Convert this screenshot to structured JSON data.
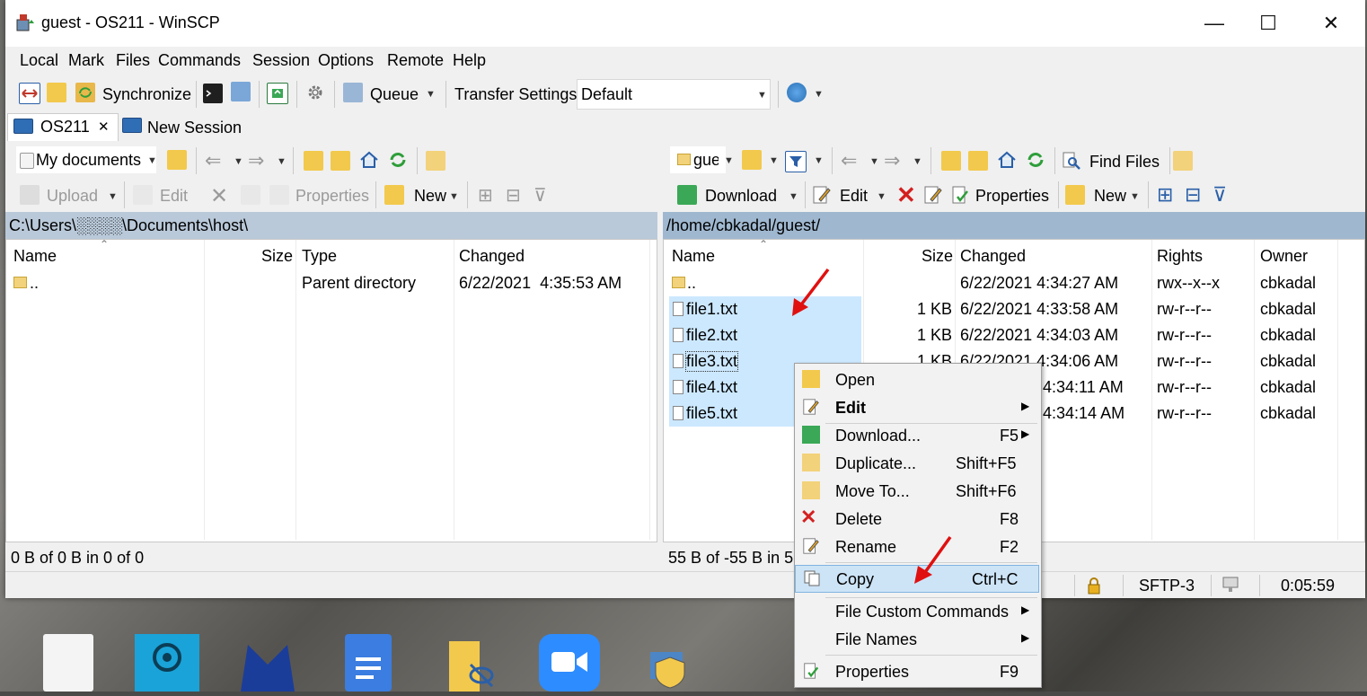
{
  "window": {
    "title": "guest - OS211 - WinSCP",
    "minimize": "—",
    "maximize": "☐",
    "close": "✕"
  },
  "menu": [
    "Local",
    "Mark",
    "Files",
    "Commands",
    "Session",
    "Options",
    "Remote",
    "Help"
  ],
  "toolbar": {
    "synchronize": "Synchronize",
    "queue": "Queue",
    "transfer_settings": "Transfer Settings",
    "transfer_value": "Default"
  },
  "tabs": {
    "session": "OS211",
    "session_close": "✕",
    "new_session": "New Session"
  },
  "local": {
    "drive": "My documents",
    "upload": "Upload",
    "edit": "Edit",
    "properties": "Properties",
    "new": "New",
    "path": "C:\\Users\\░░░░\\Documents\\host\\",
    "columns": [
      "Name",
      "Size",
      "Type",
      "Changed"
    ],
    "rows": [
      {
        "name": "..",
        "size": "",
        "type": "Parent directory",
        "changed": "6/22/2021  4:35:53 AM"
      }
    ],
    "status": "0 B of 0 B in 0 of 0"
  },
  "remote": {
    "drive": "gue",
    "find_files": "Find Files",
    "download": "Download",
    "edit": "Edit",
    "properties": "Properties",
    "new": "New",
    "path": "/home/cbkadal/guest/",
    "columns": [
      "Name",
      "Size",
      "Changed",
      "Rights",
      "Owner"
    ],
    "rows": [
      {
        "name": "..",
        "size": "",
        "changed": "6/22/2021 4:34:27 AM",
        "rights": "rwx--x--x",
        "owner": "cbkadal"
      },
      {
        "name": "file1.txt",
        "size": "1 KB",
        "changed": "6/22/2021 4:33:58 AM",
        "rights": "rw-r--r--",
        "owner": "cbkadal"
      },
      {
        "name": "file2.txt",
        "size": "1 KB",
        "changed": "6/22/2021 4:34:03 AM",
        "rights": "rw-r--r--",
        "owner": "cbkadal"
      },
      {
        "name": "file3.txt",
        "size": "1 KB",
        "changed": "6/22/2021 4:34:06 AM",
        "rights": "rw-r--r--",
        "owner": "cbkadal"
      },
      {
        "name": "file4.txt",
        "size": "",
        "changed": "4:34:11 AM",
        "rights": "rw-r--r--",
        "owner": "cbkadal"
      },
      {
        "name": "file5.txt",
        "size": "",
        "changed": "4:34:14 AM",
        "rights": "rw-r--r--",
        "owner": "cbkadal"
      }
    ],
    "status": "55 B of -55 B in 5",
    "protocol": "SFTP-3",
    "elapsed": "0:05:59"
  },
  "context_menu": {
    "items": [
      {
        "label": "Open",
        "shortcut": ""
      },
      {
        "label": "Edit",
        "shortcut": ""
      },
      {
        "label": "Download...",
        "shortcut": "F5"
      },
      {
        "label": "Duplicate...",
        "shortcut": "Shift+F5"
      },
      {
        "label": "Move To...",
        "shortcut": "Shift+F6"
      },
      {
        "label": "Delete",
        "shortcut": "F8"
      },
      {
        "label": "Rename",
        "shortcut": "F2"
      },
      {
        "label": "Copy",
        "shortcut": "Ctrl+C"
      },
      {
        "label": "File Custom Commands",
        "shortcut": ""
      },
      {
        "label": "File Names",
        "shortcut": ""
      },
      {
        "label": "Properties",
        "shortcut": "F9"
      }
    ]
  },
  "colors": {
    "selection": "#cce8ff",
    "menu_highlight": "#cde4f7",
    "path_active": "#9fb8d0",
    "path_inactive": "#b9c9d9"
  }
}
